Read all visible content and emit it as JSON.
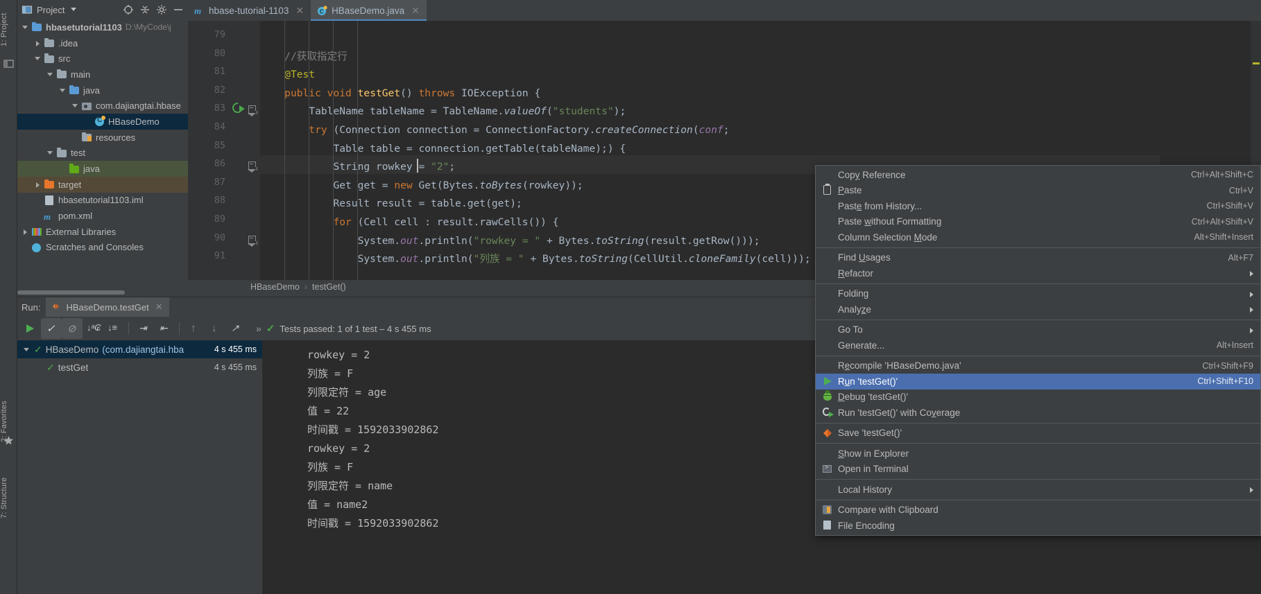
{
  "left_strip": {
    "project_tab": "1: Project",
    "favorites_tab": "2: Favorites",
    "structure_tab": "7: Structure",
    "icons": [
      "project-icon",
      "star-icon",
      "structure-icon"
    ]
  },
  "project_panel": {
    "title": "Project",
    "dropdown_icon": "chevron-down-icon",
    "toolbar_icons": [
      "locate-icon",
      "collapse-all-icon",
      "settings-gear-icon",
      "hide-icon"
    ],
    "tree": [
      {
        "label": "hbasetutorial1103",
        "path": "D:\\MyCode\\j",
        "arrow": "down",
        "icon": "module-folder-icon",
        "indent": 0,
        "bold": true,
        "state": "normal"
      },
      {
        "label": ".idea",
        "path": "",
        "arrow": "right",
        "icon": "folder-gray-icon",
        "indent": 1,
        "bold": false,
        "state": "normal"
      },
      {
        "label": "src",
        "path": "",
        "arrow": "down",
        "icon": "folder-gray-icon",
        "indent": 1,
        "bold": false,
        "state": "normal"
      },
      {
        "label": "main",
        "path": "",
        "arrow": "down",
        "icon": "folder-gray-icon",
        "indent": 2,
        "bold": false,
        "state": "normal"
      },
      {
        "label": "java",
        "path": "",
        "arrow": "down",
        "icon": "folder-blue-icon",
        "indent": 3,
        "bold": false,
        "state": "normal"
      },
      {
        "label": "com.dajiangtai.hbase",
        "path": "",
        "arrow": "down",
        "icon": "package-icon",
        "indent": 4,
        "bold": false,
        "state": "normal"
      },
      {
        "label": "HBaseDemo",
        "path": "",
        "arrow": "none",
        "icon": "java-class-icon",
        "indent": 5,
        "bold": false,
        "state": "selected"
      },
      {
        "label": "resources",
        "path": "",
        "arrow": "none",
        "icon": "resources-folder-icon",
        "indent": 4,
        "bold": false,
        "state": "normal"
      },
      {
        "label": "test",
        "path": "",
        "arrow": "down",
        "icon": "folder-gray-icon",
        "indent": 2,
        "bold": false,
        "state": "normal"
      },
      {
        "label": "java",
        "path": "",
        "arrow": "none",
        "icon": "folder-green-icon",
        "indent": 3,
        "bold": false,
        "state": "test-source"
      },
      {
        "label": "target",
        "path": "",
        "arrow": "right",
        "icon": "folder-orange-icon",
        "indent": 1,
        "bold": false,
        "state": "excluded"
      },
      {
        "label": "hbasetutorial1103.iml",
        "path": "",
        "arrow": "none",
        "icon": "iml-file-icon",
        "indent": 1,
        "bold": false,
        "state": "normal"
      },
      {
        "label": "pom.xml",
        "path": "",
        "arrow": "none",
        "icon": "maven-icon",
        "indent": 1,
        "bold": false,
        "state": "normal"
      },
      {
        "label": "External Libraries",
        "path": "",
        "arrow": "right",
        "icon": "libraries-icon",
        "indent": 0,
        "bold": false,
        "state": "normal"
      },
      {
        "label": "Scratches and Consoles",
        "path": "",
        "arrow": "none",
        "icon": "scratches-icon",
        "indent": 0,
        "bold": false,
        "state": "normal"
      }
    ]
  },
  "editor_tabs": [
    {
      "label": "hbase-tutorial-1103",
      "icon": "maven-module-icon",
      "active": false,
      "close_icon": "close-icon"
    },
    {
      "label": "HBaseDemo.java",
      "icon": "java-class-icon",
      "active": true,
      "close_icon": "close-icon"
    }
  ],
  "editor": {
    "first_line_number": 79,
    "lines": [
      {
        "num": 79,
        "indent": 0,
        "tokens": []
      },
      {
        "num": 80,
        "indent": 1,
        "tokens": [
          {
            "t": "//获取指定行",
            "c": "c"
          }
        ]
      },
      {
        "num": 81,
        "indent": 1,
        "tokens": [
          {
            "t": "@Test",
            "c": "a"
          }
        ]
      },
      {
        "num": 82,
        "indent": 1,
        "tokens": [
          {
            "t": "public",
            "c": "k"
          },
          {
            "t": " ",
            "c": "p"
          },
          {
            "t": "void",
            "c": "k"
          },
          {
            "t": " ",
            "c": "p"
          },
          {
            "t": "testGet",
            "c": "m"
          },
          {
            "t": "() ",
            "c": "p"
          },
          {
            "t": "throws",
            "c": "k"
          },
          {
            "t": " IOException {",
            "c": "p"
          }
        ]
      },
      {
        "num": 83,
        "indent": 2,
        "tokens": [
          {
            "t": "TableName tableName = TableName.",
            "c": "p"
          },
          {
            "t": "valueOf",
            "c": "st"
          },
          {
            "t": "(",
            "c": "p"
          },
          {
            "t": "\"students\"",
            "c": "s"
          },
          {
            "t": ");",
            "c": "p"
          }
        ]
      },
      {
        "num": 84,
        "indent": 2,
        "tokens": [
          {
            "t": "try",
            "c": "k"
          },
          {
            "t": " (Connection connection = ConnectionFactory.",
            "c": "p"
          },
          {
            "t": "createConnection",
            "c": "st"
          },
          {
            "t": "(",
            "c": "p"
          },
          {
            "t": "conf",
            "c": "f"
          },
          {
            "t": ";",
            "c": "p"
          }
        ]
      },
      {
        "num": 85,
        "indent": 3,
        "tokens": [
          {
            "t": "Table table = connection.getTable(tableName);) {",
            "c": "p"
          }
        ]
      },
      {
        "num": 86,
        "indent": 3,
        "tokens": [
          {
            "t": "String rowkey = ",
            "c": "p"
          },
          {
            "t": "\"2\"",
            "c": "s"
          },
          {
            "t": ";",
            "c": "p"
          }
        ],
        "highlight": true
      },
      {
        "num": 87,
        "indent": 3,
        "tokens": [
          {
            "t": "Get get = ",
            "c": "p"
          },
          {
            "t": "new",
            "c": "k"
          },
          {
            "t": " Get(Bytes.",
            "c": "p"
          },
          {
            "t": "toBytes",
            "c": "st"
          },
          {
            "t": "(rowkey));",
            "c": "p"
          }
        ]
      },
      {
        "num": 88,
        "indent": 3,
        "tokens": [
          {
            "t": "Result result = table.get(get);",
            "c": "p"
          }
        ]
      },
      {
        "num": 89,
        "indent": 3,
        "tokens": [
          {
            "t": "for",
            "c": "k"
          },
          {
            "t": " (Cell cell : result.rawCells()) {",
            "c": "p"
          }
        ]
      },
      {
        "num": 90,
        "indent": 4,
        "tokens": [
          {
            "t": "System.",
            "c": "p"
          },
          {
            "t": "out",
            "c": "f"
          },
          {
            "t": ".println(",
            "c": "p"
          },
          {
            "t": "\"rowkey = \"",
            "c": "s"
          },
          {
            "t": " + Bytes.",
            "c": "p"
          },
          {
            "t": "toString",
            "c": "st"
          },
          {
            "t": "(result.getRow()));",
            "c": "p"
          }
        ]
      },
      {
        "num": 91,
        "indent": 4,
        "tokens": [
          {
            "t": "System.",
            "c": "p"
          },
          {
            "t": "out",
            "c": "f"
          },
          {
            "t": ".println(",
            "c": "p"
          },
          {
            "t": "\"列族 = \"",
            "c": "s"
          },
          {
            "t": " + Bytes.",
            "c": "p"
          },
          {
            "t": "toString",
            "c": "st"
          },
          {
            "t": "(CellUtil.",
            "c": "p"
          },
          {
            "t": "cloneFamily",
            "c": "st"
          },
          {
            "t": "(cell)));",
            "c": "p"
          }
        ]
      }
    ],
    "run_gutter_line": 82,
    "breadcrumb": [
      "HBaseDemo",
      "testGet()"
    ],
    "breadcrumb_separator": "›"
  },
  "run_panel": {
    "run_label": "Run:",
    "tab_title": "HBaseDemo.testGet",
    "tab_icon": "junit-run-icon",
    "tab_close_icon": "close-icon",
    "toolbar_icons": [
      "rerun-icon",
      "show-passed-toggle-icon",
      "hide-ignored-icon",
      "sort-alphabetically-icon",
      "sort-by-duration-icon",
      "expand-all-icon",
      "collapse-all-icon",
      "prev-failed-icon",
      "next-failed-icon",
      "export-icon",
      "more-icon"
    ],
    "status_text": "Tests passed: 1 of 1 test – 4 s 455 ms",
    "status_icon": "check-green-icon",
    "tests": [
      {
        "label": "HBaseDemo",
        "suffix": "(com.dajiangtai.hba",
        "time": "4 s 455 ms",
        "arrow": "down",
        "icon": "check-green-icon",
        "selected": true,
        "indent": 0
      },
      {
        "label": "testGet",
        "suffix": "",
        "time": "4 s 455 ms",
        "arrow": "none",
        "icon": "check-green-icon",
        "selected": false,
        "indent": 1
      }
    ],
    "console_output": [
      "rowkey = 2",
      "列族 = F",
      "列限定符 = age",
      "值 = 22",
      "时间戳 = 1592033902862",
      "rowkey = 2",
      "列族 = F",
      "列限定符 = name",
      "值 = name2",
      "时间戳 = 1592033902862"
    ]
  },
  "context_menu": {
    "items": [
      {
        "label": "Copy Reference",
        "keys": "Ctrl+Alt+Shift+C",
        "icon": "",
        "submenu": false,
        "highlighted": false,
        "mnemonic": "y"
      },
      {
        "label": "Paste",
        "keys": "Ctrl+V",
        "icon": "paste-clipboard-icon",
        "submenu": false,
        "highlighted": false,
        "mnemonic": "P"
      },
      {
        "label": "Paste from History...",
        "keys": "Ctrl+Shift+V",
        "icon": "",
        "submenu": false,
        "highlighted": false,
        "mnemonic": "e"
      },
      {
        "label": "Paste without Formatting",
        "keys": "Ctrl+Alt+Shift+V",
        "icon": "",
        "submenu": false,
        "highlighted": false,
        "mnemonic": "w"
      },
      {
        "label": "Column Selection Mode",
        "keys": "Alt+Shift+Insert",
        "icon": "",
        "submenu": false,
        "highlighted": false,
        "mnemonic": "M"
      },
      {
        "separator": true
      },
      {
        "label": "Find Usages",
        "keys": "Alt+F7",
        "icon": "",
        "submenu": false,
        "highlighted": false,
        "mnemonic": "U"
      },
      {
        "label": "Refactor",
        "keys": "",
        "icon": "",
        "submenu": true,
        "highlighted": false,
        "mnemonic": "R"
      },
      {
        "separator": true
      },
      {
        "label": "Folding",
        "keys": "",
        "icon": "",
        "submenu": true,
        "highlighted": false,
        "mnemonic": ""
      },
      {
        "label": "Analyze",
        "keys": "",
        "icon": "",
        "submenu": true,
        "highlighted": false,
        "mnemonic": "z"
      },
      {
        "separator": true
      },
      {
        "label": "Go To",
        "keys": "",
        "icon": "",
        "submenu": true,
        "highlighted": false,
        "mnemonic": ""
      },
      {
        "label": "Generate...",
        "keys": "Alt+Insert",
        "icon": "",
        "submenu": false,
        "highlighted": false,
        "mnemonic": ""
      },
      {
        "separator": true
      },
      {
        "label": "Recompile 'HBaseDemo.java'",
        "keys": "Ctrl+Shift+F9",
        "icon": "",
        "submenu": false,
        "highlighted": false,
        "mnemonic": "e"
      },
      {
        "label": "Run 'testGet()'",
        "keys": "Ctrl+Shift+F10",
        "icon": "run-green-icon",
        "submenu": false,
        "highlighted": true,
        "mnemonic": "u"
      },
      {
        "label": "Debug 'testGet()'",
        "keys": "",
        "icon": "debug-bug-icon",
        "submenu": false,
        "highlighted": false,
        "mnemonic": "D"
      },
      {
        "label": "Run 'testGet()' with Coverage",
        "keys": "",
        "icon": "coverage-icon",
        "submenu": false,
        "highlighted": false,
        "mnemonic": "v"
      },
      {
        "separator": true
      },
      {
        "label": "Save 'testGet()'",
        "keys": "",
        "icon": "save-config-icon",
        "submenu": false,
        "highlighted": false,
        "mnemonic": ""
      },
      {
        "separator": true
      },
      {
        "label": "Show in Explorer",
        "keys": "",
        "icon": "",
        "submenu": false,
        "highlighted": false,
        "mnemonic": "S"
      },
      {
        "label": "Open in Terminal",
        "keys": "",
        "icon": "terminal-icon",
        "submenu": false,
        "highlighted": false,
        "mnemonic": ""
      },
      {
        "separator": true
      },
      {
        "label": "Local History",
        "keys": "",
        "icon": "",
        "submenu": true,
        "highlighted": false,
        "mnemonic": ""
      },
      {
        "separator": true
      },
      {
        "label": "Compare with Clipboard",
        "keys": "",
        "icon": "compare-icon",
        "submenu": false,
        "highlighted": false,
        "mnemonic": ""
      },
      {
        "label": "File Encoding",
        "keys": "",
        "icon": "file-encoding-icon",
        "submenu": false,
        "highlighted": false,
        "mnemonic": ""
      }
    ]
  },
  "colors": {
    "background": "#3c3f41",
    "editor_background": "#2b2b2b",
    "selection_blue": "#0d293e",
    "menu_highlight": "#4b6eaf",
    "accent_green": "#4caf50",
    "tab_underline": "#4a88c7"
  }
}
